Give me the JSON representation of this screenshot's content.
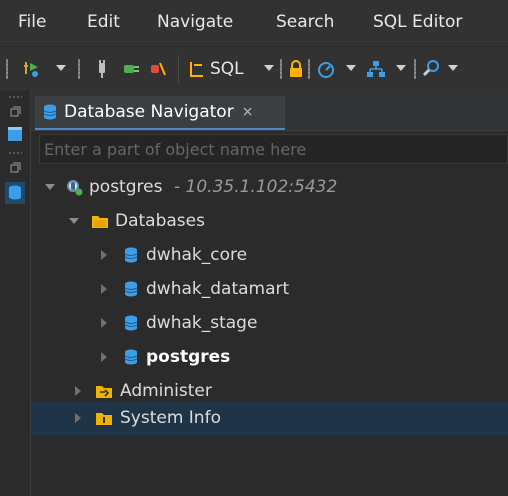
{
  "menu": {
    "items": [
      "File",
      "Edit",
      "Navigate",
      "Search",
      "SQL Editor"
    ]
  },
  "toolbar": {
    "sql_label": "SQL"
  },
  "navigator": {
    "tab_title": "Database Navigator",
    "tab_close": "×",
    "filter_placeholder": "Enter a part of object name here",
    "connection": {
      "name": "postgres",
      "host": " - 10.35.1.102:5432"
    },
    "databases_label": "Databases",
    "databases": [
      {
        "name": "dwhak_core",
        "bold": false
      },
      {
        "name": "dwhak_datamart",
        "bold": false
      },
      {
        "name": "dwhak_stage",
        "bold": false
      },
      {
        "name": "postgres",
        "bold": true
      }
    ],
    "administer_label": "Administer",
    "system_info_label": "System Info"
  },
  "colors": {
    "accent": "#4a88c7",
    "db_icon": "#3d9ee8",
    "folder_icon": "#f0b400",
    "selection": "#1f3447"
  }
}
